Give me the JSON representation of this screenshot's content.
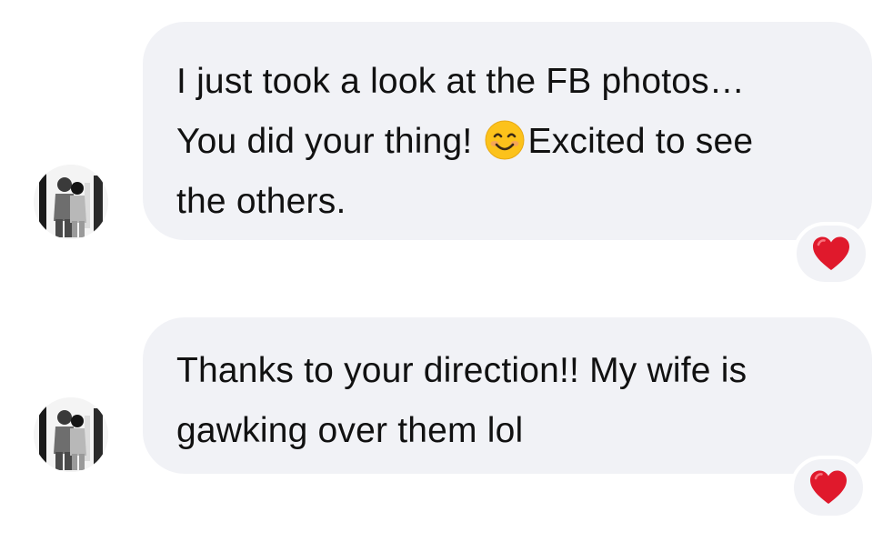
{
  "messages": [
    {
      "lines": [
        "I just took a look at the FB photos…",
        "You did your thing!",
        "Excited to see",
        "the others."
      ],
      "inline_emoji": "smiling-face-emoji",
      "reaction": "heart",
      "avatar": "contact-avatar"
    },
    {
      "lines": [
        "Thanks to your direction!! My wife is",
        "gawking over them lol"
      ],
      "reaction": "heart",
      "avatar": "contact-avatar"
    }
  ],
  "colors": {
    "bubble_background": "#f1f2f6",
    "text": "#111111",
    "heart": "#e0192c",
    "emoji_face": "#fcc21b"
  }
}
